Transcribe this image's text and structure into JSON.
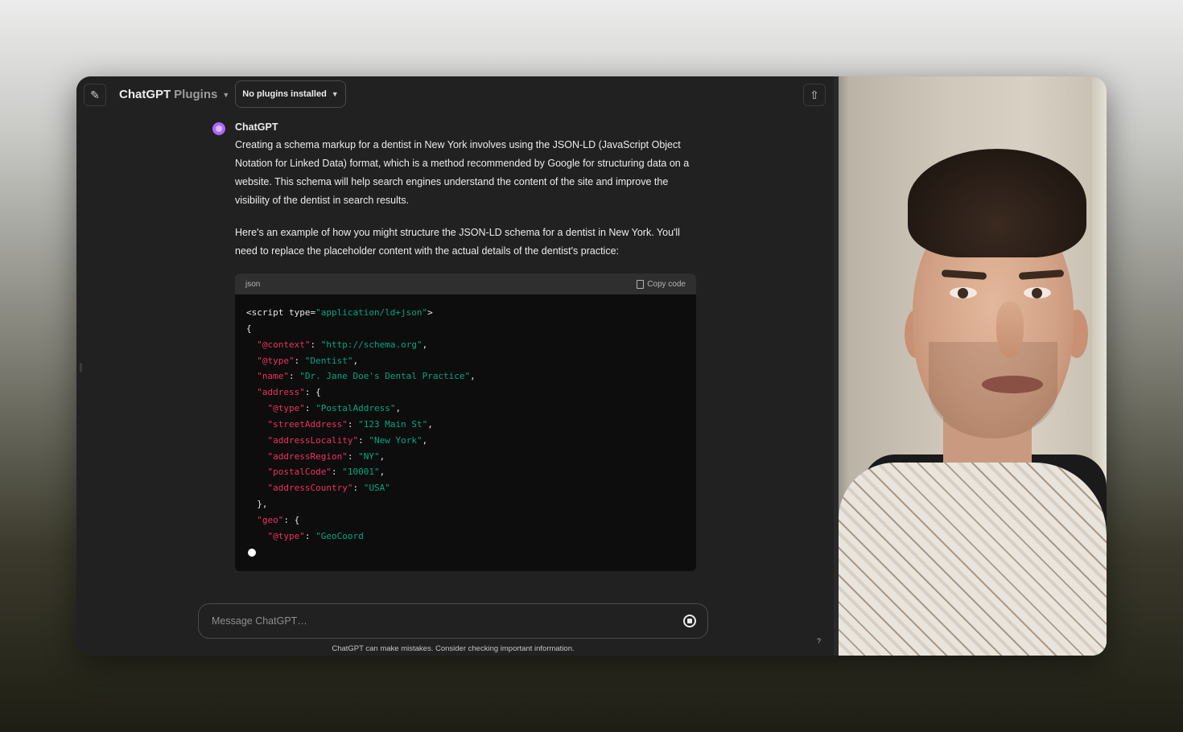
{
  "header": {
    "brand": "ChatGPT",
    "brand_sub": "Plugins",
    "plugins_label": "No plugins installed"
  },
  "message": {
    "sender": "ChatGPT",
    "paragraphs": [
      "Creating a schema markup for a dentist in New York involves using the JSON-LD (JavaScript Object Notation for Linked Data) format, which is a method recommended by Google for structuring data on a website. This schema will help search engines understand the content of the site and improve the visibility of the dentist in search results.",
      "Here's an example of how you might structure the JSON-LD schema for a dentist in New York. You'll need to replace the placeholder content with the actual details of the dentist's practice:"
    ]
  },
  "code": {
    "language": "json",
    "copy_label": "Copy code",
    "lines": [
      [
        [
          "p",
          "<script type="
        ],
        [
          "s",
          "\"application/ld+json\""
        ],
        [
          "p",
          ">"
        ]
      ],
      [
        [
          "p",
          "{"
        ]
      ],
      [
        [
          "p",
          "  "
        ],
        [
          "k",
          "\"@context\""
        ],
        [
          "p",
          ": "
        ],
        [
          "s",
          "\"http://schema.org\""
        ],
        [
          "p",
          ","
        ]
      ],
      [
        [
          "p",
          "  "
        ],
        [
          "k",
          "\"@type\""
        ],
        [
          "p",
          ": "
        ],
        [
          "s",
          "\"Dentist\""
        ],
        [
          "p",
          ","
        ]
      ],
      [
        [
          "p",
          "  "
        ],
        [
          "k",
          "\"name\""
        ],
        [
          "p",
          ": "
        ],
        [
          "s",
          "\"Dr. Jane Doe's Dental Practice\""
        ],
        [
          "p",
          ","
        ]
      ],
      [
        [
          "p",
          "  "
        ],
        [
          "k",
          "\"address\""
        ],
        [
          "p",
          ": {"
        ]
      ],
      [
        [
          "p",
          "    "
        ],
        [
          "k",
          "\"@type\""
        ],
        [
          "p",
          ": "
        ],
        [
          "s",
          "\"PostalAddress\""
        ],
        [
          "p",
          ","
        ]
      ],
      [
        [
          "p",
          "    "
        ],
        [
          "k",
          "\"streetAddress\""
        ],
        [
          "p",
          ": "
        ],
        [
          "s",
          "\"123 Main St\""
        ],
        [
          "p",
          ","
        ]
      ],
      [
        [
          "p",
          "    "
        ],
        [
          "k",
          "\"addressLocality\""
        ],
        [
          "p",
          ": "
        ],
        [
          "s",
          "\"New York\""
        ],
        [
          "p",
          ","
        ]
      ],
      [
        [
          "p",
          "    "
        ],
        [
          "k",
          "\"addressRegion\""
        ],
        [
          "p",
          ": "
        ],
        [
          "s",
          "\"NY\""
        ],
        [
          "p",
          ","
        ]
      ],
      [
        [
          "p",
          "    "
        ],
        [
          "k",
          "\"postalCode\""
        ],
        [
          "p",
          ": "
        ],
        [
          "s",
          "\"10001\""
        ],
        [
          "p",
          ","
        ]
      ],
      [
        [
          "p",
          "    "
        ],
        [
          "k",
          "\"addressCountry\""
        ],
        [
          "p",
          ": "
        ],
        [
          "s",
          "\"USA\""
        ]
      ],
      [
        [
          "p",
          "  },"
        ]
      ],
      [
        [
          "p",
          "  "
        ],
        [
          "k",
          "\"geo\""
        ],
        [
          "p",
          ": {"
        ]
      ],
      [
        [
          "p",
          "    "
        ],
        [
          "k",
          "\"@type\""
        ],
        [
          "p",
          ": "
        ],
        [
          "s",
          "\"GeoCoord"
        ]
      ]
    ]
  },
  "composer": {
    "placeholder": "Message ChatGPT…"
  },
  "disclaimer": "ChatGPT can make mistakes. Consider checking important information.",
  "help_label": "?",
  "icons": {
    "new_chat": "✎",
    "share": "⇧"
  }
}
